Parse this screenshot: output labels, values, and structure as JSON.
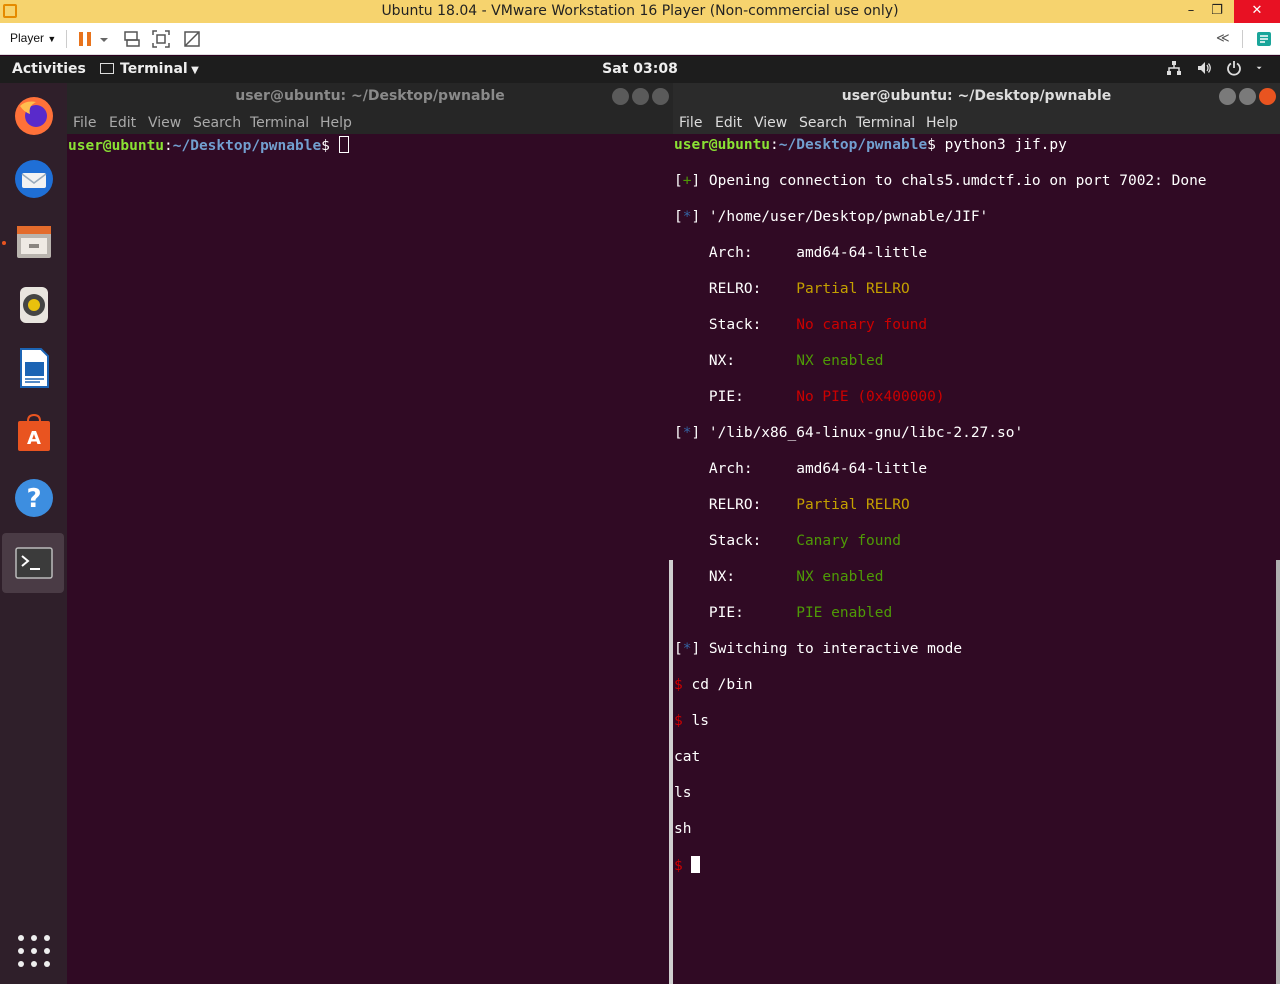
{
  "vm": {
    "title": "Ubuntu 18.04 - VMware Workstation 16 Player (Non-commercial use only)",
    "player_label": "Player",
    "minimize": "–",
    "restore": "❐",
    "close": "✕",
    "unity_label": "≪"
  },
  "topbar": {
    "activities": "Activities",
    "app_menu": "Terminal",
    "clock": "Sat 03:08"
  },
  "dock": {
    "items": [
      {
        "name": "Firefox",
        "icon": "firefox-icon"
      },
      {
        "name": "Thunderbird",
        "icon": "thunderbird-icon"
      },
      {
        "name": "Files",
        "icon": "files-icon"
      },
      {
        "name": "Rhythmbox",
        "icon": "rhythmbox-icon"
      },
      {
        "name": "LibreOffice Writer",
        "icon": "writer-icon"
      },
      {
        "name": "Ubuntu Software",
        "icon": "software-icon"
      },
      {
        "name": "Help",
        "icon": "help-icon"
      },
      {
        "name": "Terminal",
        "icon": "terminal-icon"
      }
    ],
    "app_grid_icon": "app-grid-icon"
  },
  "left_terminal": {
    "title": "user@ubuntu: ~/Desktop/pwnable",
    "menu": [
      "File",
      "Edit",
      "View",
      "Search",
      "Terminal",
      "Help"
    ],
    "prompt_user": "user@ubuntu",
    "prompt_sep": ":",
    "prompt_path": "~/Desktop/pwnable",
    "prompt_end": "$ "
  },
  "right_terminal": {
    "title": "user@ubuntu: ~/Desktop/pwnable",
    "menu": [
      "File",
      "Edit",
      "View",
      "Search",
      "Terminal",
      "Help"
    ],
    "prompt_user": "user@ubuntu",
    "prompt_sep": ":",
    "prompt_path": "~/Desktop/pwnable",
    "prompt_end": "$ ",
    "command": "python3 jif.py",
    "lines": {
      "open_tag": "+",
      "open_text": " Opening connection to chals5.umdctf.io on port 7002: Done",
      "bin1_tag": "*",
      "bin1_text": " '/home/user/Desktop/pwnable/JIF'",
      "bin1_arch_label": "    Arch:     ",
      "bin1_arch": "amd64-64-little",
      "bin1_relro_label": "    RELRO:    ",
      "bin1_relro": "Partial RELRO",
      "bin1_stack_label": "    Stack:    ",
      "bin1_stack": "No canary found",
      "bin1_nx_label": "    NX:       ",
      "bin1_nx": "NX enabled",
      "bin1_pie_label": "    PIE:      ",
      "bin1_pie": "No PIE (0x400000)",
      "bin2_tag": "*",
      "bin2_text": " '/lib/x86_64-linux-gnu/libc-2.27.so'",
      "bin2_arch_label": "    Arch:     ",
      "bin2_arch": "amd64-64-little",
      "bin2_relro_label": "    RELRO:    ",
      "bin2_relro": "Partial RELRO",
      "bin2_stack_label": "    Stack:    ",
      "bin2_stack": "Canary found",
      "bin2_nx_label": "    NX:       ",
      "bin2_nx": "NX enabled",
      "bin2_pie_label": "    PIE:      ",
      "bin2_pie": "PIE enabled",
      "switch_tag": "*",
      "switch_text": " Switching to interactive mode",
      "shell_prompt": "$ ",
      "cmd1": "cd /bin",
      "cmd2": "ls",
      "out1": "cat",
      "out2": "ls",
      "out3": "sh"
    }
  },
  "colors": {
    "terminal_bg": "#300a24",
    "prompt_user": "#8ae234",
    "prompt_path": "#729fcf",
    "good": "#4e9a06",
    "bad": "#cc0000",
    "warn": "#c4a000",
    "vm_title_bg": "#f6d36e",
    "ubuntu_orange": "#e95420"
  }
}
